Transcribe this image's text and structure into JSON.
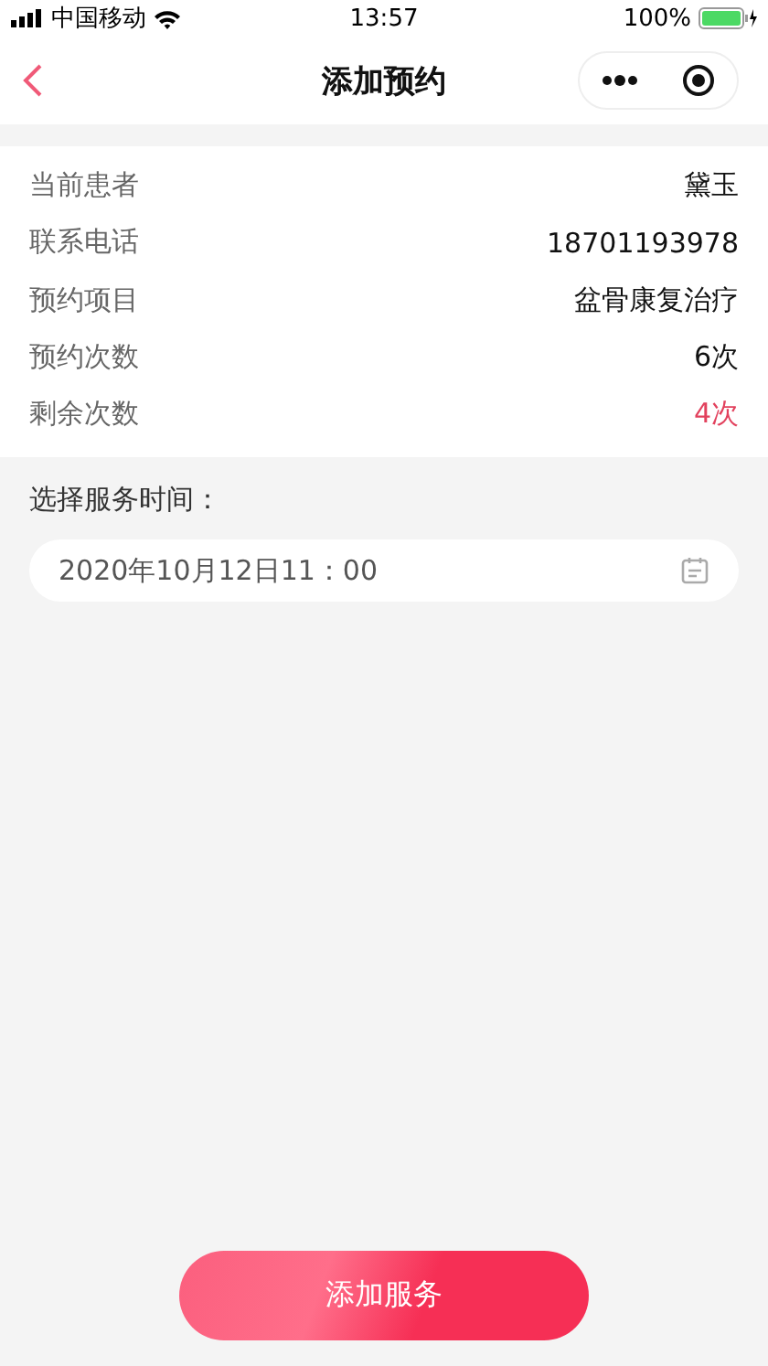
{
  "status_bar": {
    "carrier": "中国移动",
    "time": "13:57",
    "battery": "100%"
  },
  "nav": {
    "title": "添加预约"
  },
  "info_rows": [
    {
      "label": "当前患者",
      "value": "黛玉",
      "highlight": false
    },
    {
      "label": "联系电话",
      "value": "18701193978",
      "highlight": false
    },
    {
      "label": "预约项目",
      "value": "盆骨康复治疗",
      "highlight": false
    },
    {
      "label": "预约次数",
      "value": "6次",
      "highlight": false
    },
    {
      "label": "剩余次数",
      "value": "4次",
      "highlight": true
    }
  ],
  "time_section": {
    "label": "选择服务时间：",
    "value": "2020年10月12日11：00"
  },
  "submit_button": "添加服务"
}
